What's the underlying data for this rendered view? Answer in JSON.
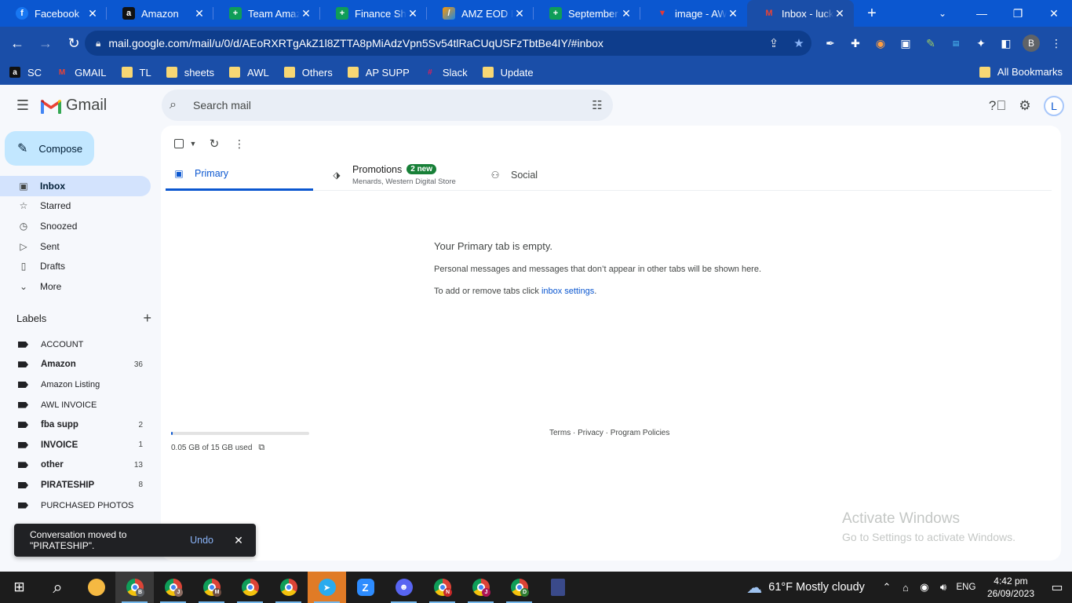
{
  "browser": {
    "tabs": [
      {
        "label": "Facebook",
        "icon": "facebook-icon",
        "fav": "f",
        "cls": "fav-fb"
      },
      {
        "label": "Amazon",
        "icon": "amazon-icon",
        "fav": "a",
        "cls": "fav-amz"
      },
      {
        "label": "Team Amazing",
        "icon": "google-sheets-icon",
        "fav": "+",
        "cls": "fav-sheet"
      },
      {
        "label": "Finance Sheet",
        "icon": "google-sheets-icon",
        "fav": "+",
        "cls": "fav-sheet"
      },
      {
        "label": "AMZ EOD Report",
        "icon": "eod-app-icon",
        "fav": "/",
        "cls": "fav-eod"
      },
      {
        "label": "September P",
        "icon": "google-sheets-icon",
        "fav": "+",
        "cls": "fav-sheet"
      },
      {
        "label": "image - AWL",
        "icon": "image-icon",
        "fav": "▼",
        "cls": "fav-img"
      },
      {
        "label": "Inbox - lucky",
        "icon": "gmail-icon",
        "fav": "M",
        "cls": "fav-gmail"
      }
    ],
    "active_tab_index": 7,
    "url": "mail.google.com/mail/u/0/d/AEoRXRTgAkZ1l8ZTTA8pMiAdzVpn5Sv54tlRaCUqUSFzTbtBe4IY/#inbox",
    "profile_initial": "B",
    "bookmarks": [
      {
        "label": "SC",
        "icon": "amazon-icon",
        "glyph": "a"
      },
      {
        "label": "GMAIL",
        "icon": "gmail-icon",
        "glyph": "M"
      },
      {
        "label": "TL",
        "icon": "folder-icon",
        "glyph": ""
      },
      {
        "label": "sheets",
        "icon": "folder-icon",
        "glyph": ""
      },
      {
        "label": "AWL",
        "icon": "folder-icon",
        "glyph": ""
      },
      {
        "label": "Others",
        "icon": "folder-icon",
        "glyph": ""
      },
      {
        "label": "AP SUPP",
        "icon": "folder-icon",
        "glyph": ""
      },
      {
        "label": "Slack",
        "icon": "slack-icon",
        "glyph": "#"
      },
      {
        "label": "Update",
        "icon": "folder-icon",
        "glyph": ""
      }
    ],
    "all_bookmarks": "All Bookmarks"
  },
  "gmail": {
    "app_name": "Gmail",
    "search_placeholder": "Search mail",
    "account_initial": "L",
    "compose_label": "Compose",
    "nav": [
      {
        "label": "Inbox",
        "icon": "inbox-icon",
        "glyph": "▣",
        "active": true
      },
      {
        "label": "Starred",
        "icon": "star-icon",
        "glyph": "☆"
      },
      {
        "label": "Snoozed",
        "icon": "clock-icon",
        "glyph": "◷"
      },
      {
        "label": "Sent",
        "icon": "send-icon",
        "glyph": "▷"
      },
      {
        "label": "Drafts",
        "icon": "draft-icon",
        "glyph": "▯"
      },
      {
        "label": "More",
        "icon": "chevron-down-icon",
        "glyph": "⌄"
      }
    ],
    "labels_heading": "Labels",
    "labels": [
      {
        "name": "ACCOUNT",
        "count": "",
        "bold": false
      },
      {
        "name": "Amazon",
        "count": "36",
        "bold": true
      },
      {
        "name": "Amazon Listing",
        "count": "",
        "bold": false
      },
      {
        "name": "AWL INVOICE",
        "count": "",
        "bold": false
      },
      {
        "name": "fba supp",
        "count": "2",
        "bold": true
      },
      {
        "name": "INVOICE",
        "count": "1",
        "bold": true
      },
      {
        "name": "other",
        "count": "13",
        "bold": true
      },
      {
        "name": "PIRATESHIP",
        "count": "8",
        "bold": true
      },
      {
        "name": "PURCHASED PHOTOS",
        "count": "",
        "bold": false
      }
    ],
    "tabs": {
      "primary": "Primary",
      "promotions": "Promotions",
      "promotions_badge": "2 new",
      "promotions_sub": "Menards, Western Digital Store",
      "social": "Social"
    },
    "empty": {
      "title": "Your Primary tab is empty.",
      "line1": "Personal messages and messages that don’t appear in other tabs will be shown here.",
      "line2_prefix": "To add or remove tabs click ",
      "line2_link": "inbox settings",
      "line2_suffix": "."
    },
    "storage": {
      "text": "0.05 GB of 15 GB used",
      "fraction": 0.0033
    },
    "footer": "Terms · Privacy · Program Policies",
    "snackbar": {
      "message": "Conversation moved to \"PIRATESHIP\".",
      "action": "Undo"
    }
  },
  "watermark": {
    "line1": "Activate Windows",
    "line2": "Go to Settings to activate Windows."
  },
  "taskbar": {
    "weather": "61°F  Mostly cloudy",
    "language": "ENG",
    "time": "4:42 pm",
    "date": "26/09/2023"
  },
  "colors": {
    "accent": "#0b57d0",
    "chrome_frame": "#1a4ea8",
    "compose_bg": "#c2e7ff",
    "active_nav": "#d3e3fd"
  }
}
